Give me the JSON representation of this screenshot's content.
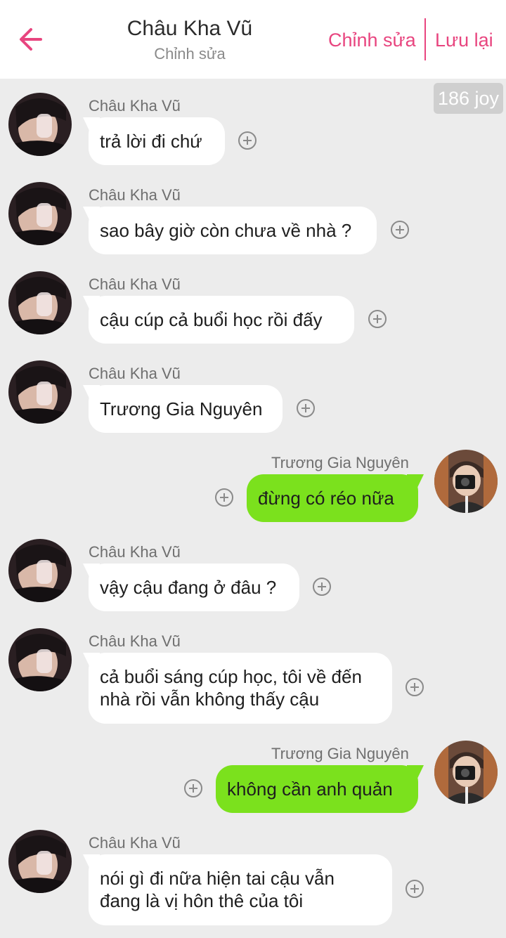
{
  "header": {
    "title": "Châu Kha Vũ",
    "subtitle": "Chỉnh sửa",
    "edit_label": "Chỉnh sửa",
    "save_label": "Lưu lại",
    "back_icon": "arrow-left-icon"
  },
  "badge": {
    "text": "186 joy"
  },
  "colors": {
    "accent": "#e8457f",
    "bubble_left": "#ffffff",
    "bubble_right": "#7be11d",
    "background": "#ececec"
  },
  "messages": [
    {
      "side": "left",
      "sender": "Châu Kha Vũ",
      "lines": [
        "trả lời đi chứ"
      ]
    },
    {
      "side": "left",
      "sender": "Châu Kha Vũ",
      "lines": [
        "sao bây giờ còn chưa về nhà ?"
      ]
    },
    {
      "side": "left",
      "sender": "Châu Kha Vũ",
      "lines": [
        "cậu cúp cả buổi học rồi đấy"
      ]
    },
    {
      "side": "left",
      "sender": "Châu Kha Vũ",
      "lines": [
        "Trương Gia Nguyên"
      ]
    },
    {
      "side": "right",
      "sender": "Trương Gia Nguyên",
      "lines": [
        "đừng có réo nữa"
      ]
    },
    {
      "side": "left",
      "sender": "Châu Kha Vũ",
      "lines": [
        "vậy cậu đang ở đâu ?"
      ]
    },
    {
      "side": "left",
      "sender": "Châu Kha Vũ",
      "lines": [
        "cả buổi sáng cúp học, tôi về đến",
        "nhà rồi vẫn không thấy cậu"
      ]
    },
    {
      "side": "right",
      "sender": "Trương Gia Nguyên",
      "lines": [
        "không cần anh quản"
      ]
    },
    {
      "side": "left",
      "sender": "Châu Kha Vũ",
      "lines": [
        "nói gì đi nữa hiện tai cậu vẫn",
        "đang là vị hôn thê của tôi"
      ]
    }
  ]
}
